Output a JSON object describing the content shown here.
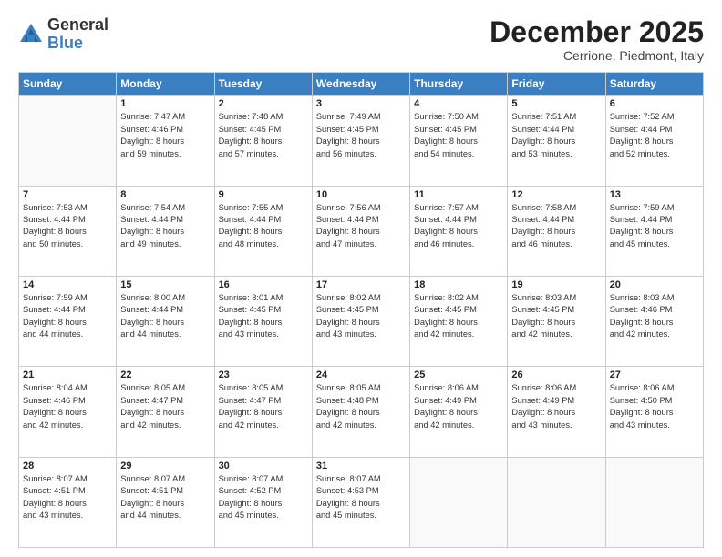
{
  "header": {
    "logo_general": "General",
    "logo_blue": "Blue",
    "month_title": "December 2025",
    "location": "Cerrione, Piedmont, Italy"
  },
  "weekdays": [
    "Sunday",
    "Monday",
    "Tuesday",
    "Wednesday",
    "Thursday",
    "Friday",
    "Saturday"
  ],
  "weeks": [
    [
      {
        "day": "",
        "sunrise": "",
        "sunset": "",
        "daylight": ""
      },
      {
        "day": "1",
        "sunrise": "Sunrise: 7:47 AM",
        "sunset": "Sunset: 4:46 PM",
        "daylight": "Daylight: 8 hours and 59 minutes."
      },
      {
        "day": "2",
        "sunrise": "Sunrise: 7:48 AM",
        "sunset": "Sunset: 4:45 PM",
        "daylight": "Daylight: 8 hours and 57 minutes."
      },
      {
        "day": "3",
        "sunrise": "Sunrise: 7:49 AM",
        "sunset": "Sunset: 4:45 PM",
        "daylight": "Daylight: 8 hours and 56 minutes."
      },
      {
        "day": "4",
        "sunrise": "Sunrise: 7:50 AM",
        "sunset": "Sunset: 4:45 PM",
        "daylight": "Daylight: 8 hours and 54 minutes."
      },
      {
        "day": "5",
        "sunrise": "Sunrise: 7:51 AM",
        "sunset": "Sunset: 4:44 PM",
        "daylight": "Daylight: 8 hours and 53 minutes."
      },
      {
        "day": "6",
        "sunrise": "Sunrise: 7:52 AM",
        "sunset": "Sunset: 4:44 PM",
        "daylight": "Daylight: 8 hours and 52 minutes."
      }
    ],
    [
      {
        "day": "7",
        "sunrise": "Sunrise: 7:53 AM",
        "sunset": "Sunset: 4:44 PM",
        "daylight": "Daylight: 8 hours and 50 minutes."
      },
      {
        "day": "8",
        "sunrise": "Sunrise: 7:54 AM",
        "sunset": "Sunset: 4:44 PM",
        "daylight": "Daylight: 8 hours and 49 minutes."
      },
      {
        "day": "9",
        "sunrise": "Sunrise: 7:55 AM",
        "sunset": "Sunset: 4:44 PM",
        "daylight": "Daylight: 8 hours and 48 minutes."
      },
      {
        "day": "10",
        "sunrise": "Sunrise: 7:56 AM",
        "sunset": "Sunset: 4:44 PM",
        "daylight": "Daylight: 8 hours and 47 minutes."
      },
      {
        "day": "11",
        "sunrise": "Sunrise: 7:57 AM",
        "sunset": "Sunset: 4:44 PM",
        "daylight": "Daylight: 8 hours and 46 minutes."
      },
      {
        "day": "12",
        "sunrise": "Sunrise: 7:58 AM",
        "sunset": "Sunset: 4:44 PM",
        "daylight": "Daylight: 8 hours and 46 minutes."
      },
      {
        "day": "13",
        "sunrise": "Sunrise: 7:59 AM",
        "sunset": "Sunset: 4:44 PM",
        "daylight": "Daylight: 8 hours and 45 minutes."
      }
    ],
    [
      {
        "day": "14",
        "sunrise": "Sunrise: 7:59 AM",
        "sunset": "Sunset: 4:44 PM",
        "daylight": "Daylight: 8 hours and 44 minutes."
      },
      {
        "day": "15",
        "sunrise": "Sunrise: 8:00 AM",
        "sunset": "Sunset: 4:44 PM",
        "daylight": "Daylight: 8 hours and 44 minutes."
      },
      {
        "day": "16",
        "sunrise": "Sunrise: 8:01 AM",
        "sunset": "Sunset: 4:45 PM",
        "daylight": "Daylight: 8 hours and 43 minutes."
      },
      {
        "day": "17",
        "sunrise": "Sunrise: 8:02 AM",
        "sunset": "Sunset: 4:45 PM",
        "daylight": "Daylight: 8 hours and 43 minutes."
      },
      {
        "day": "18",
        "sunrise": "Sunrise: 8:02 AM",
        "sunset": "Sunset: 4:45 PM",
        "daylight": "Daylight: 8 hours and 42 minutes."
      },
      {
        "day": "19",
        "sunrise": "Sunrise: 8:03 AM",
        "sunset": "Sunset: 4:45 PM",
        "daylight": "Daylight: 8 hours and 42 minutes."
      },
      {
        "day": "20",
        "sunrise": "Sunrise: 8:03 AM",
        "sunset": "Sunset: 4:46 PM",
        "daylight": "Daylight: 8 hours and 42 minutes."
      }
    ],
    [
      {
        "day": "21",
        "sunrise": "Sunrise: 8:04 AM",
        "sunset": "Sunset: 4:46 PM",
        "daylight": "Daylight: 8 hours and 42 minutes."
      },
      {
        "day": "22",
        "sunrise": "Sunrise: 8:05 AM",
        "sunset": "Sunset: 4:47 PM",
        "daylight": "Daylight: 8 hours and 42 minutes."
      },
      {
        "day": "23",
        "sunrise": "Sunrise: 8:05 AM",
        "sunset": "Sunset: 4:47 PM",
        "daylight": "Daylight: 8 hours and 42 minutes."
      },
      {
        "day": "24",
        "sunrise": "Sunrise: 8:05 AM",
        "sunset": "Sunset: 4:48 PM",
        "daylight": "Daylight: 8 hours and 42 minutes."
      },
      {
        "day": "25",
        "sunrise": "Sunrise: 8:06 AM",
        "sunset": "Sunset: 4:49 PM",
        "daylight": "Daylight: 8 hours and 42 minutes."
      },
      {
        "day": "26",
        "sunrise": "Sunrise: 8:06 AM",
        "sunset": "Sunset: 4:49 PM",
        "daylight": "Daylight: 8 hours and 43 minutes."
      },
      {
        "day": "27",
        "sunrise": "Sunrise: 8:06 AM",
        "sunset": "Sunset: 4:50 PM",
        "daylight": "Daylight: 8 hours and 43 minutes."
      }
    ],
    [
      {
        "day": "28",
        "sunrise": "Sunrise: 8:07 AM",
        "sunset": "Sunset: 4:51 PM",
        "daylight": "Daylight: 8 hours and 43 minutes."
      },
      {
        "day": "29",
        "sunrise": "Sunrise: 8:07 AM",
        "sunset": "Sunset: 4:51 PM",
        "daylight": "Daylight: 8 hours and 44 minutes."
      },
      {
        "day": "30",
        "sunrise": "Sunrise: 8:07 AM",
        "sunset": "Sunset: 4:52 PM",
        "daylight": "Daylight: 8 hours and 45 minutes."
      },
      {
        "day": "31",
        "sunrise": "Sunrise: 8:07 AM",
        "sunset": "Sunset: 4:53 PM",
        "daylight": "Daylight: 8 hours and 45 minutes."
      },
      {
        "day": "",
        "sunrise": "",
        "sunset": "",
        "daylight": ""
      },
      {
        "day": "",
        "sunrise": "",
        "sunset": "",
        "daylight": ""
      },
      {
        "day": "",
        "sunrise": "",
        "sunset": "",
        "daylight": ""
      }
    ]
  ]
}
